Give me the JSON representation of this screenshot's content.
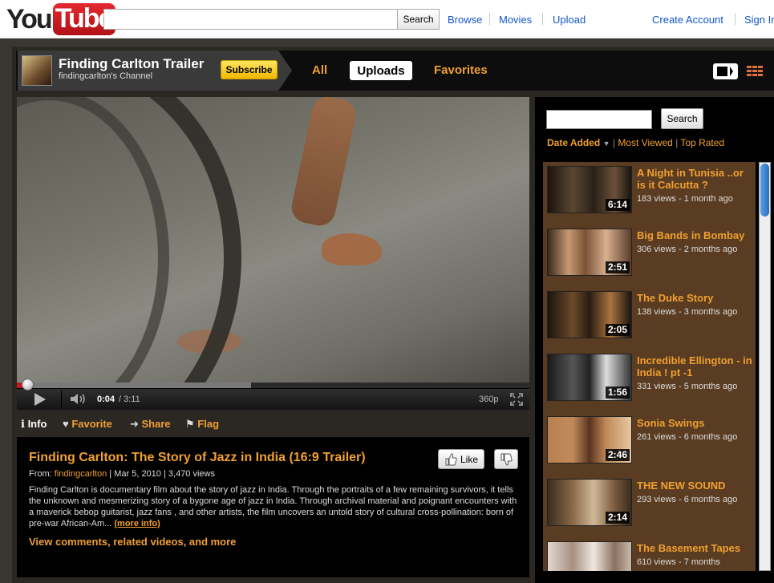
{
  "topbar": {
    "logo_you": "You",
    "logo_tube": "Tube",
    "search_button": "Search",
    "links": [
      "Browse",
      "Movies",
      "Upload"
    ],
    "create_account": "Create Account",
    "sign_in": "Sign In"
  },
  "channel": {
    "title": "Finding Carlton Trailer",
    "subtitle": "findingcarlton's Channel",
    "subscribe": "Subscribe",
    "tabs": [
      "All",
      "Uploads",
      "Favorites"
    ]
  },
  "player": {
    "time_current": "0:04",
    "time_total": "/ 3:11",
    "quality": "360p",
    "progress_fraction": 0.021
  },
  "video_tabs": [
    "Info",
    "Favorite",
    "Share",
    "Flag"
  ],
  "info": {
    "title": "Finding Carlton: The Story of Jazz in India (16:9 Trailer)",
    "like": "Like",
    "from_label": "From:",
    "from_user": "findingcarlton",
    "date": "| Mar 5, 2010",
    "views": "| 3,470 views",
    "description": "Finding Carlton is documentary film about the story of jazz in India. Through the portraits of a few remaining survivors, it tells the unknown and mesmerizing story of a bygone age of jazz in India. Through archival material and poignant encounters with a maverick bebop guitarist, jazz fans , and other artists, the film uncovers an untold story of cultural cross-pollination: born of pre-war African-Am...",
    "more_info": "(more info)",
    "view_comments": "View comments, related videos, and more"
  },
  "sidebar": {
    "search_button": "Search",
    "sort_date": "Date Added",
    "sort_viewed": "Most Viewed",
    "sort_rated": "Top Rated",
    "divider": "|",
    "videos": [
      {
        "title": "A Night in Tunisia ..or is it Calcutta ?",
        "meta": "183 views - 1 month ago",
        "duration": "6:14"
      },
      {
        "title": "Big Bands in Bombay",
        "meta": "306 views - 2 months ago",
        "duration": "2:51"
      },
      {
        "title": "The Duke Story",
        "meta": "138 views - 3 months ago",
        "duration": "2:05"
      },
      {
        "title": "Incredible Ellington - in India ! pt -1",
        "meta": "331 views - 5 months ago",
        "duration": "1:56"
      },
      {
        "title": "Sonia Swings",
        "meta": "261 views - 6 months ago",
        "duration": "2:46"
      },
      {
        "title": "THE NEW SOUND",
        "meta": "293 views - 6 months ago",
        "duration": "2:14"
      },
      {
        "title": "The Basement Tapes",
        "meta": "610 views - 7 months",
        "duration": ""
      }
    ]
  },
  "colors": {
    "accent": "#f0a030",
    "link": "#1155cc",
    "brand_red": "#cc181e",
    "list_bg": "#5a3c22"
  }
}
